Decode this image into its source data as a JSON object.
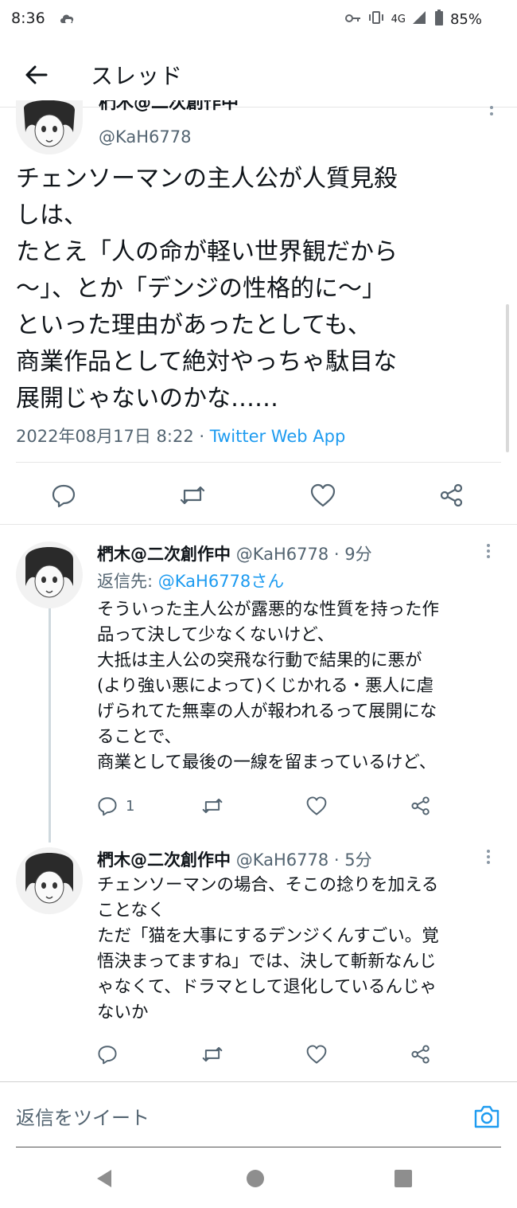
{
  "status_bar": {
    "time": "8:36",
    "network": "4G",
    "battery": "85%"
  },
  "header": {
    "title": "スレッド",
    "back_icon": "arrow-left-icon"
  },
  "main_tweet": {
    "name": "椚木@二次創作中",
    "handle": "@KaH6778",
    "text": "チェンソーマンの主人公が人質見殺\nしは、\nたとえ「人の命が軽い世界観だから\n〜」、とか「デンジの性格的に〜」\nといった理由があったとしても、\n商業作品として絶対やっちゃ駄目な\n展開じゃないのかな……",
    "date": "2022年08月17日 8:22 · ",
    "source": "Twitter Web App"
  },
  "replies": [
    {
      "name": "椚木@二次創作中",
      "handle": "@KaH6778 · 9分",
      "reply_to_label": "返信先: ",
      "reply_to_user": "@KaH6778さん",
      "text": "そういった主人公が露悪的な性質を持った作\n品って決して少なくないけど、\n大抵は主人公の突飛な行動で結果的に悪が\n(より強い悪によって)くじかれる・悪人に虐\nげられてた無辜の人が報われるって展開にな\nることで、\n商業として最後の一線を留まっているけど、",
      "reply_count": "1"
    },
    {
      "name": "椚木@二次創作中",
      "handle": "@KaH6778 · 5分",
      "text": "チェンソーマンの場合、そこの捻りを加える\nことなく\nただ「猫を大事にするデンジくんすごい。覚\n悟決まってますね」では、決して斬新なんじ\nゃなくて、ドラマとして退化しているんじゃ\nないか",
      "reply_count": ""
    }
  ],
  "compose": {
    "placeholder": "返信をツイート"
  },
  "colors": {
    "accent": "#1d9bf0",
    "text": "#0f1419",
    "secondary": "#536471"
  }
}
